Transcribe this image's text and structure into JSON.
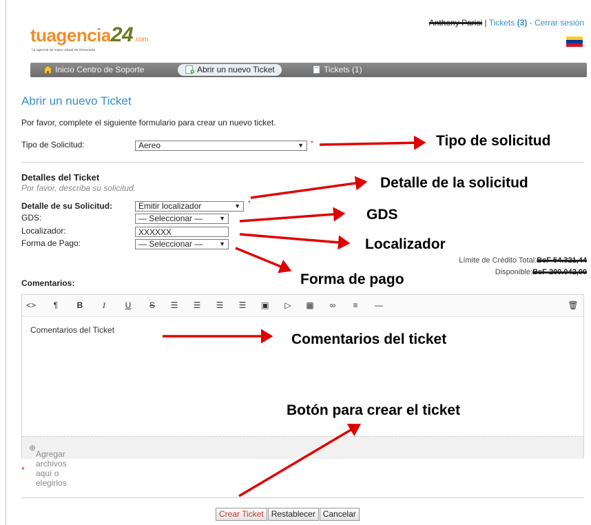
{
  "header": {
    "logo_main": "tuagencia",
    "logo_num": "24",
    "logo_com": ".com",
    "logo_tagline": "La agencia de viajes virtual de Venezuela",
    "user_name": "Anthony Parisi",
    "separator": "|",
    "tickets_label": "Tickets",
    "tickets_count": "(3)",
    "dash": "-",
    "logout_label": "Cerrar sesión",
    "flag_colors": [
      "#f7d117",
      "#0033a0",
      "#cf142b"
    ]
  },
  "nav": {
    "tabs": [
      {
        "label": "Inicio Centro de Soporte",
        "icon": "home-icon"
      },
      {
        "label": "Abrir un nuevo Ticket",
        "icon": "new-ticket-icon"
      },
      {
        "label": "Tickets (1)",
        "icon": "tickets-icon"
      }
    ]
  },
  "page": {
    "title": "Abrir un nuevo Ticket",
    "intro": "Por favor, complete el siguiente formulario para crear un nuevo ticket."
  },
  "form": {
    "request_type_label": "Tipo de Solicitud:",
    "request_type_value": "Aereo",
    "required_mark": "*",
    "details_title": "Detalles del Ticket",
    "details_subtitle": "Por favor, describa su solicitud.",
    "detail_label": "Detalle de su Solicitud:",
    "detail_value": "Emitir localizador",
    "gds_label": "GDS:",
    "gds_value": "— Seleccionar —",
    "locator_label": "Localizador:",
    "locator_value": "XXXXXX",
    "payment_label": "Forma de Pago:",
    "payment_value": "— Seleccionar —",
    "credit_total_label": "Límite de Crédito Total:",
    "credit_total_value": "BsF 54.321,44",
    "available_label": "Disponible:",
    "available_value": "BsF 200.042,00",
    "comments_label": "Comentarios:",
    "comments_text": "Comentarios del Ticket",
    "dropzone_text": "Agregar archivos aquí o elegirlos"
  },
  "toolbar": {
    "icons": [
      "code-icon",
      "paragraph-icon",
      "bold-icon",
      "italic-icon",
      "underline-icon",
      "strikethrough-icon",
      "unordered-list-icon",
      "ordered-list-icon",
      "outdent-icon",
      "indent-icon",
      "image-icon",
      "video-icon",
      "table-icon",
      "link-icon",
      "align-icon",
      "horizontal-rule-icon"
    ],
    "trash_icon": "trash-icon"
  },
  "buttons": {
    "create": "Crear Ticket",
    "reset": "Restablecer",
    "cancel": "Cancelar"
  },
  "annotations": {
    "request_type": "Tipo de solicitud",
    "detail": "Detalle de la solicitud",
    "gds": "GDS",
    "locator": "Localizador",
    "payment": "Forma de pago",
    "comments": "Comentarios del ticket",
    "create_button": "Botón para crear el ticket",
    "arrow_color": "#e00000"
  }
}
